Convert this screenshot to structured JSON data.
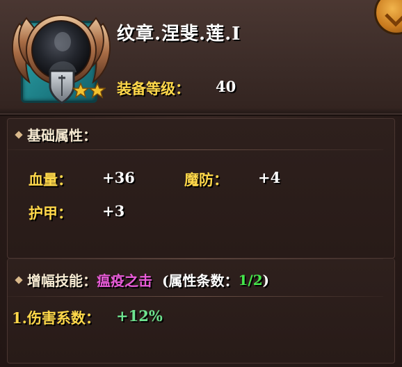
{
  "item": {
    "name": "纹章.涅斐.莲.I",
    "level_label": "装备等级：",
    "level_value": "40",
    "stars": 2,
    "icon": "emblem-icon"
  },
  "base_attributes": {
    "title": "基础属性：",
    "stats": [
      {
        "label": "血量：",
        "value": "+36"
      },
      {
        "label": "魔防：",
        "value": "+4"
      },
      {
        "label": "护甲：",
        "value": "+3"
      }
    ]
  },
  "amplify_skill": {
    "title": "增幅技能：",
    "skill_name": "瘟疫之击",
    "attr_count_prefix": "(属性条数：",
    "attr_count": "1/2",
    "attr_count_suffix": ")",
    "effects": [
      {
        "label": "1.伤害系数：",
        "value": "+12%"
      }
    ]
  },
  "colors": {
    "label_gold": "#ffd84a",
    "skill_purple": "#e85bd8",
    "count_green": "#44e64a",
    "effect_green": "#6ee38f",
    "teal_frame": "#2fa8ad"
  }
}
